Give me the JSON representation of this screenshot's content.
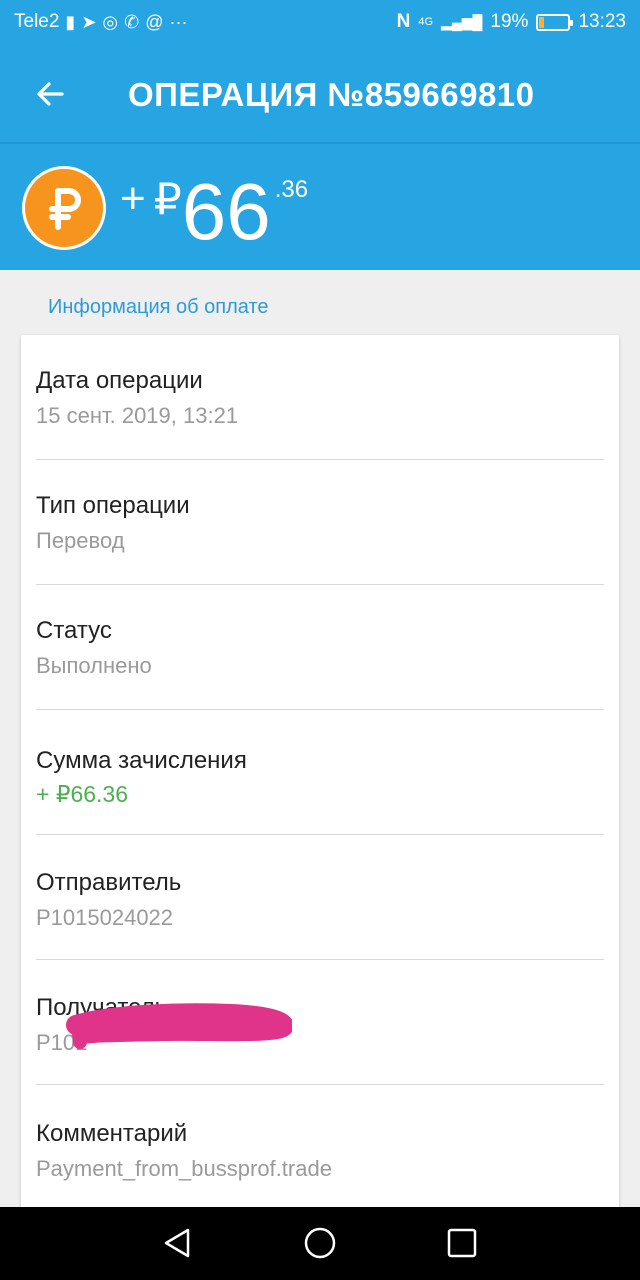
{
  "status_bar": {
    "carrier": "Tele2",
    "network": "4G",
    "battery": "19%",
    "battery_level": 0.19,
    "time": "13:23"
  },
  "header": {
    "title": "ОПЕРАЦИЯ №859669810"
  },
  "amount": {
    "sign": "+",
    "currency": "₽",
    "integer": "66",
    "decimal": ".36"
  },
  "section_title": "Информация об оплате",
  "details": [
    {
      "label": "Дата операции",
      "value": "15 сент. 2019, 13:21"
    },
    {
      "label": "Тип операции",
      "value": "Перевод"
    },
    {
      "label": "Статус",
      "value": "Выполнено"
    },
    {
      "label": "Сумма зачисления",
      "value": "+ ₽66.36"
    },
    {
      "label": "Отправитель",
      "value": "P1015024022"
    },
    {
      "label": "Получатель",
      "value": "P101"
    },
    {
      "label": "Комментарий",
      "value": "Payment_from_bussprof.trade"
    }
  ],
  "colors": {
    "primary": "#26a5e2",
    "coin": "#f7941d",
    "success": "#4caf50",
    "redaction": "#e0338a"
  }
}
